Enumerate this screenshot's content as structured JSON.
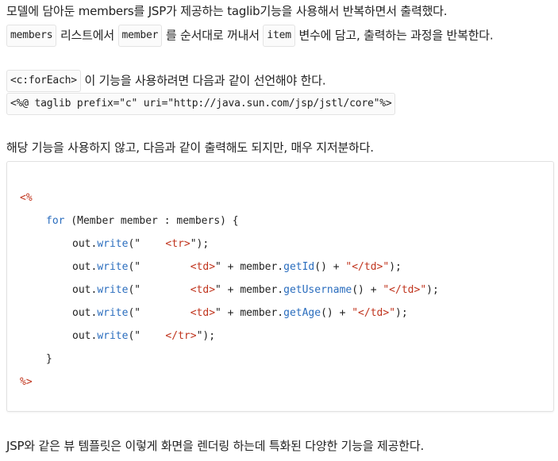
{
  "para1": {
    "line1": "모델에 담아둔 members를 JSP가 제공하는 taglib기능을 사용해서 반복하면서 출력했다.",
    "chip_members": "members",
    "text_a": " 리스트에서 ",
    "chip_member": "member",
    "text_b": " 를 순서대로 꺼내서 ",
    "chip_item": "item",
    "text_c": " 변수에 담고, 출력하는 과정을 반복한다."
  },
  "para2": {
    "chip_foreach": "<c:forEach>",
    "text": " 이 기능을 사용하려면 다음과 같이 선언해야 한다.",
    "taglib_decl": "<%@ taglib prefix=\"c\" uri=\"http://java.sun.com/jsp/jstl/core\"%>"
  },
  "para3": {
    "text": "해당 기능을 사용하지 않고, 다음과 같이 출력해도 되지만, 매우 지저분하다."
  },
  "code": {
    "open_tag": "<%",
    "for_kw": "for",
    "for_rest": " (Member member : members) {",
    "out": "out",
    "dot": ".",
    "write": "write",
    "paren_open": "(",
    "q": "\"",
    "l1_str": "    <tr>",
    "l1_end": "\");",
    "l2_str": "        <td>",
    "l2_mid": "\" + member.",
    "l2_fn": "getId",
    "l2_after": "() + ",
    "l2_close": "\"</td>\"",
    "l2_end": ");",
    "l3_str": "        <td>",
    "l3_mid": "\" + member.",
    "l3_fn": "getUsername",
    "l3_after": "() + ",
    "l3_close": "\"</td>\"",
    "l3_end": ");",
    "l4_str": "        <td>",
    "l4_mid": "\" + member.",
    "l4_fn": "getAge",
    "l4_after": "() + ",
    "l4_close": "\"</td>\"",
    "l4_end": ");",
    "l5_str": "    </tr>",
    "l5_end": "\");",
    "brace_close": "}",
    "close_tag": "%>"
  },
  "para4": {
    "text": "JSP와 같은 뷰 템플릿은 이렇게 화면을 렌더링 하는데 특화된 다양한 기능을 제공한다."
  },
  "colors": {
    "tag_red": "#c0341d",
    "keyword_blue": "#2a6dbe",
    "text": "#222222"
  }
}
